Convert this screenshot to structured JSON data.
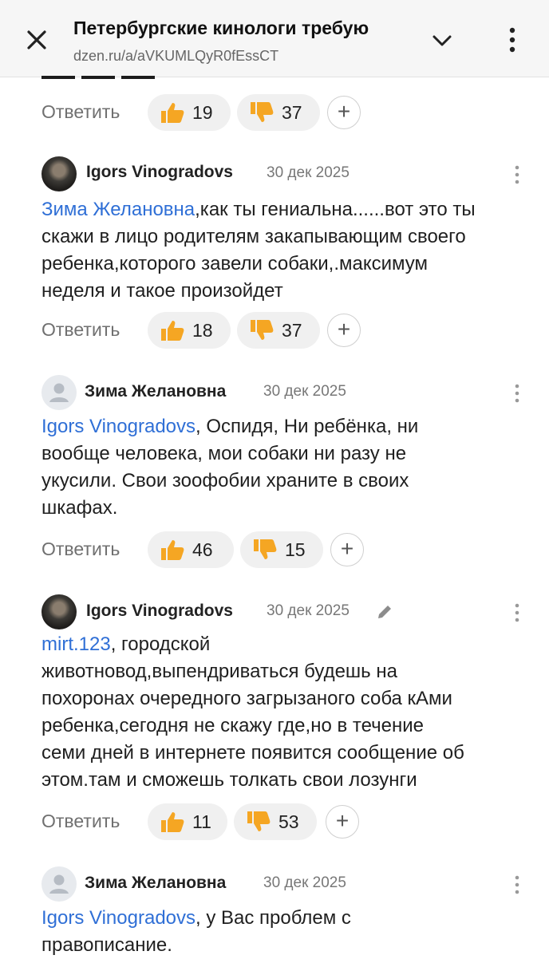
{
  "header": {
    "title": "Петербургские кинологи требую",
    "url": "dzen.ru/a/aVKUMLQyR0fEssCT"
  },
  "first_actions": {
    "reply": "Ответить",
    "likes": "19",
    "dislikes": "37"
  },
  "comments": [
    {
      "author": "Igors Vinogradovs",
      "date": "30 дек 2025",
      "mention": "Зима Желановна",
      "lines": [
        "Зима Желановна",
        ",как ты гениальна......вот это ты",
        "скажи в лицо родителям закапывающим своего",
        "ребенка,которого завели собаки,.максимум",
        "неделя и такое произойдет"
      ],
      "reply": "Ответить",
      "likes": "18",
      "dislikes": "37"
    },
    {
      "author": "Зима Желановна",
      "date": "30 дек 2025",
      "lines": [
        "Igors Vinogradovs",
        ", Оспидя, Ни ребёнка, ни",
        "вообще человека, мои собаки ни разу не",
        "укусили. Свои зоофобии храните в своих",
        "шкафах."
      ],
      "reply": "Ответить",
      "likes": "46",
      "dislikes": "15"
    },
    {
      "author": "Igors Vinogradovs",
      "date": "30 дек 2025",
      "edited_icon": "pencil-icon",
      "lines": [
        "mirt.123",
        ", городской",
        "животновод,выпендриваться будешь на",
        "похоронах очередного загрызаного соба кАми",
        "ребенка,сегодня не скажу где,но в течение",
        "семи дней в интернете появится сообщение об",
        "этом.там и сможешь толкать свои лозунги"
      ],
      "reply": "Ответить",
      "likes": "11",
      "dislikes": "53"
    },
    {
      "author": "Зима Желановна",
      "date": "30 дек 2025",
      "lines": [
        "Igors Vinogradovs",
        ", у Вас проблем с",
        "правописание."
      ]
    }
  ],
  "colors": {
    "mention": "#2f6fd6",
    "thumb": "#f5a623",
    "pill_bg": "#f0f0f0"
  }
}
